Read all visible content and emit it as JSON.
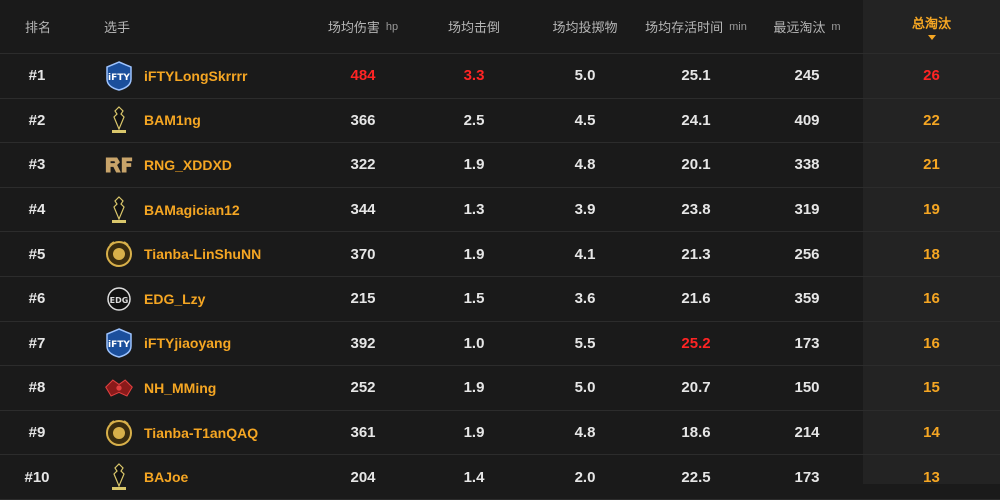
{
  "headers": {
    "rank": "排名",
    "player": "选手",
    "damage": "场均伤害",
    "damage_unit": "hp",
    "kills": "场均击倒",
    "throws": "场均投掷物",
    "survival": "场均存活时间",
    "survival_unit": "min",
    "farthest": "最远淘汰",
    "farthest_unit": "m",
    "total": "总淘汰"
  },
  "colors": {
    "accent": "#f5a623",
    "highlight": "#ff2424"
  },
  "rows": [
    {
      "rank": "#1",
      "team_logo": "ifty-logo-icon",
      "player": "iFTYLongSkrrrr",
      "damage": "484",
      "kills": "3.3",
      "throws": "5.0",
      "survival": "25.1",
      "farthest": "245",
      "total": "26"
    },
    {
      "rank": "#2",
      "team_logo": "black-anaconda-logo-icon",
      "player": "BAM1ng",
      "damage": "366",
      "kills": "2.5",
      "throws": "4.5",
      "survival": "24.1",
      "farthest": "409",
      "total": "22"
    },
    {
      "rank": "#3",
      "team_logo": "rng-logo-icon",
      "player": "RNG_XDDXD",
      "damage": "322",
      "kills": "1.9",
      "throws": "4.8",
      "survival": "20.1",
      "farthest": "338",
      "total": "21"
    },
    {
      "rank": "#4",
      "team_logo": "black-anaconda-logo-icon",
      "player": "BAMagician12",
      "damage": "344",
      "kills": "1.3",
      "throws": "3.9",
      "survival": "23.8",
      "farthest": "319",
      "total": "19"
    },
    {
      "rank": "#5",
      "team_logo": "tianba-logo-icon",
      "player": "Tianba-LinShuNN",
      "damage": "370",
      "kills": "1.9",
      "throws": "4.1",
      "survival": "21.3",
      "farthest": "256",
      "total": "18"
    },
    {
      "rank": "#6",
      "team_logo": "edg-logo-icon",
      "player": "EDG_Lzy",
      "damage": "215",
      "kills": "1.5",
      "throws": "3.6",
      "survival": "21.6",
      "farthest": "359",
      "total": "16"
    },
    {
      "rank": "#7",
      "team_logo": "ifty-logo-icon",
      "player": "iFTYjiaoyang",
      "damage": "392",
      "kills": "1.0",
      "throws": "5.5",
      "survival": "25.2",
      "farthest": "173",
      "total": "16"
    },
    {
      "rank": "#8",
      "team_logo": "nh-logo-icon",
      "player": "NH_MMing",
      "damage": "252",
      "kills": "1.9",
      "throws": "5.0",
      "survival": "20.7",
      "farthest": "150",
      "total": "15"
    },
    {
      "rank": "#9",
      "team_logo": "tianba-logo-icon",
      "player": "Tianba-T1anQAQ",
      "damage": "361",
      "kills": "1.9",
      "throws": "4.8",
      "survival": "18.6",
      "farthest": "214",
      "total": "14"
    },
    {
      "rank": "#10",
      "team_logo": "black-anaconda-logo-icon",
      "player": "BAJoe",
      "damage": "204",
      "kills": "1.4",
      "throws": "2.0",
      "survival": "22.5",
      "farthest": "173",
      "total": "13"
    }
  ]
}
